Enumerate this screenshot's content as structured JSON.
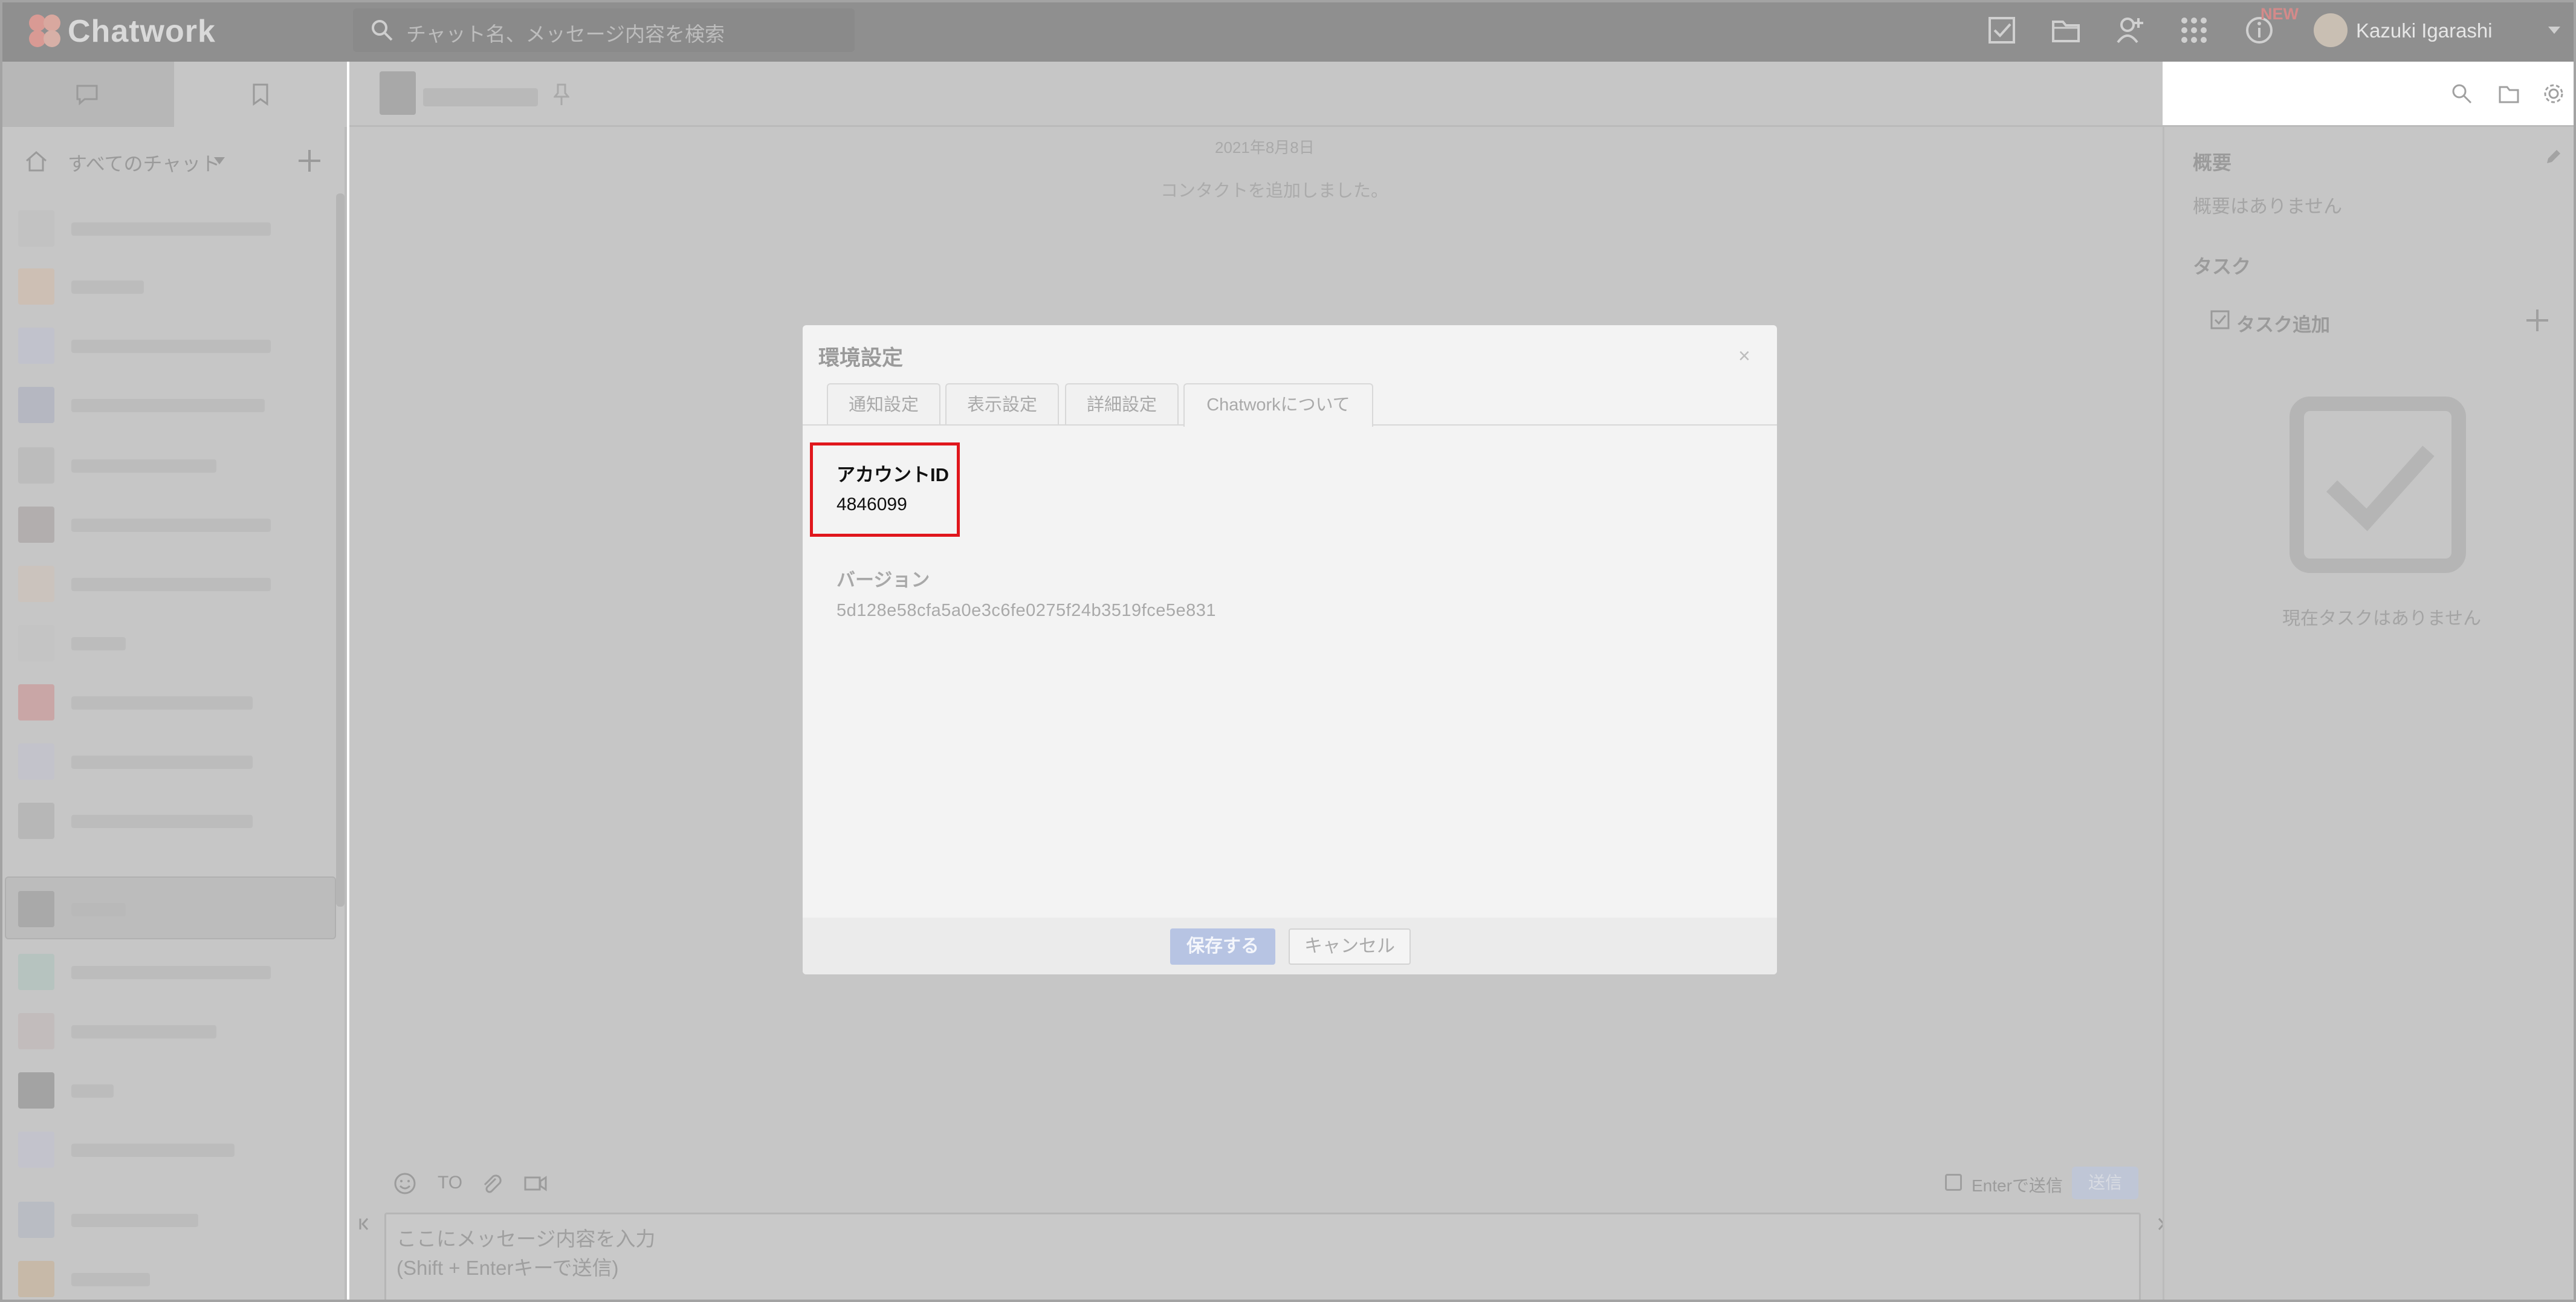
{
  "header": {
    "app_name": "Chatwork",
    "search_placeholder": "チャット名、メッセージ内容を検索",
    "new_badge": "NEW",
    "user_name": "Kazuki Igarashi",
    "icons": [
      "task-check-icon",
      "folder-icon",
      "add-contact-icon",
      "apps-grid-icon",
      "info-icon"
    ]
  },
  "sidebar": {
    "filter_label": "すべてのチャット"
  },
  "chat": {
    "date": "2021年8月8日",
    "system_message": "コンタクトを追加しました。",
    "to_label": "TO",
    "enter_send_label": "Enterで送信",
    "send_label": "送信",
    "composer_placeholder_line1": "ここにメッセージ内容を入力",
    "composer_placeholder_line2": "(Shift + Enterキーで送信)"
  },
  "right_panel": {
    "summary_title": "概要",
    "summary_empty": "概要はありません",
    "task_title": "タスク",
    "add_task": "タスク追加",
    "task_empty": "現在タスクはありません"
  },
  "modal": {
    "title": "環境設定",
    "close": "×",
    "tabs": [
      {
        "label": "通知設定"
      },
      {
        "label": "表示設定"
      },
      {
        "label": "詳細設定"
      },
      {
        "label": "Chatworkについて"
      }
    ],
    "account_id_label": "アカウントID",
    "account_id_value": "4846099",
    "version_label": "バージョン",
    "version_value": "5d128e58cfa5a0e3c6fe0275f24b3519fce5e831",
    "save_label": "保存する",
    "cancel_label": "キャンセル"
  },
  "colors": {
    "overlay_gray": "#c6c6c6",
    "highlight_red": "#e0161c",
    "save_button": "#b7c4e3"
  }
}
